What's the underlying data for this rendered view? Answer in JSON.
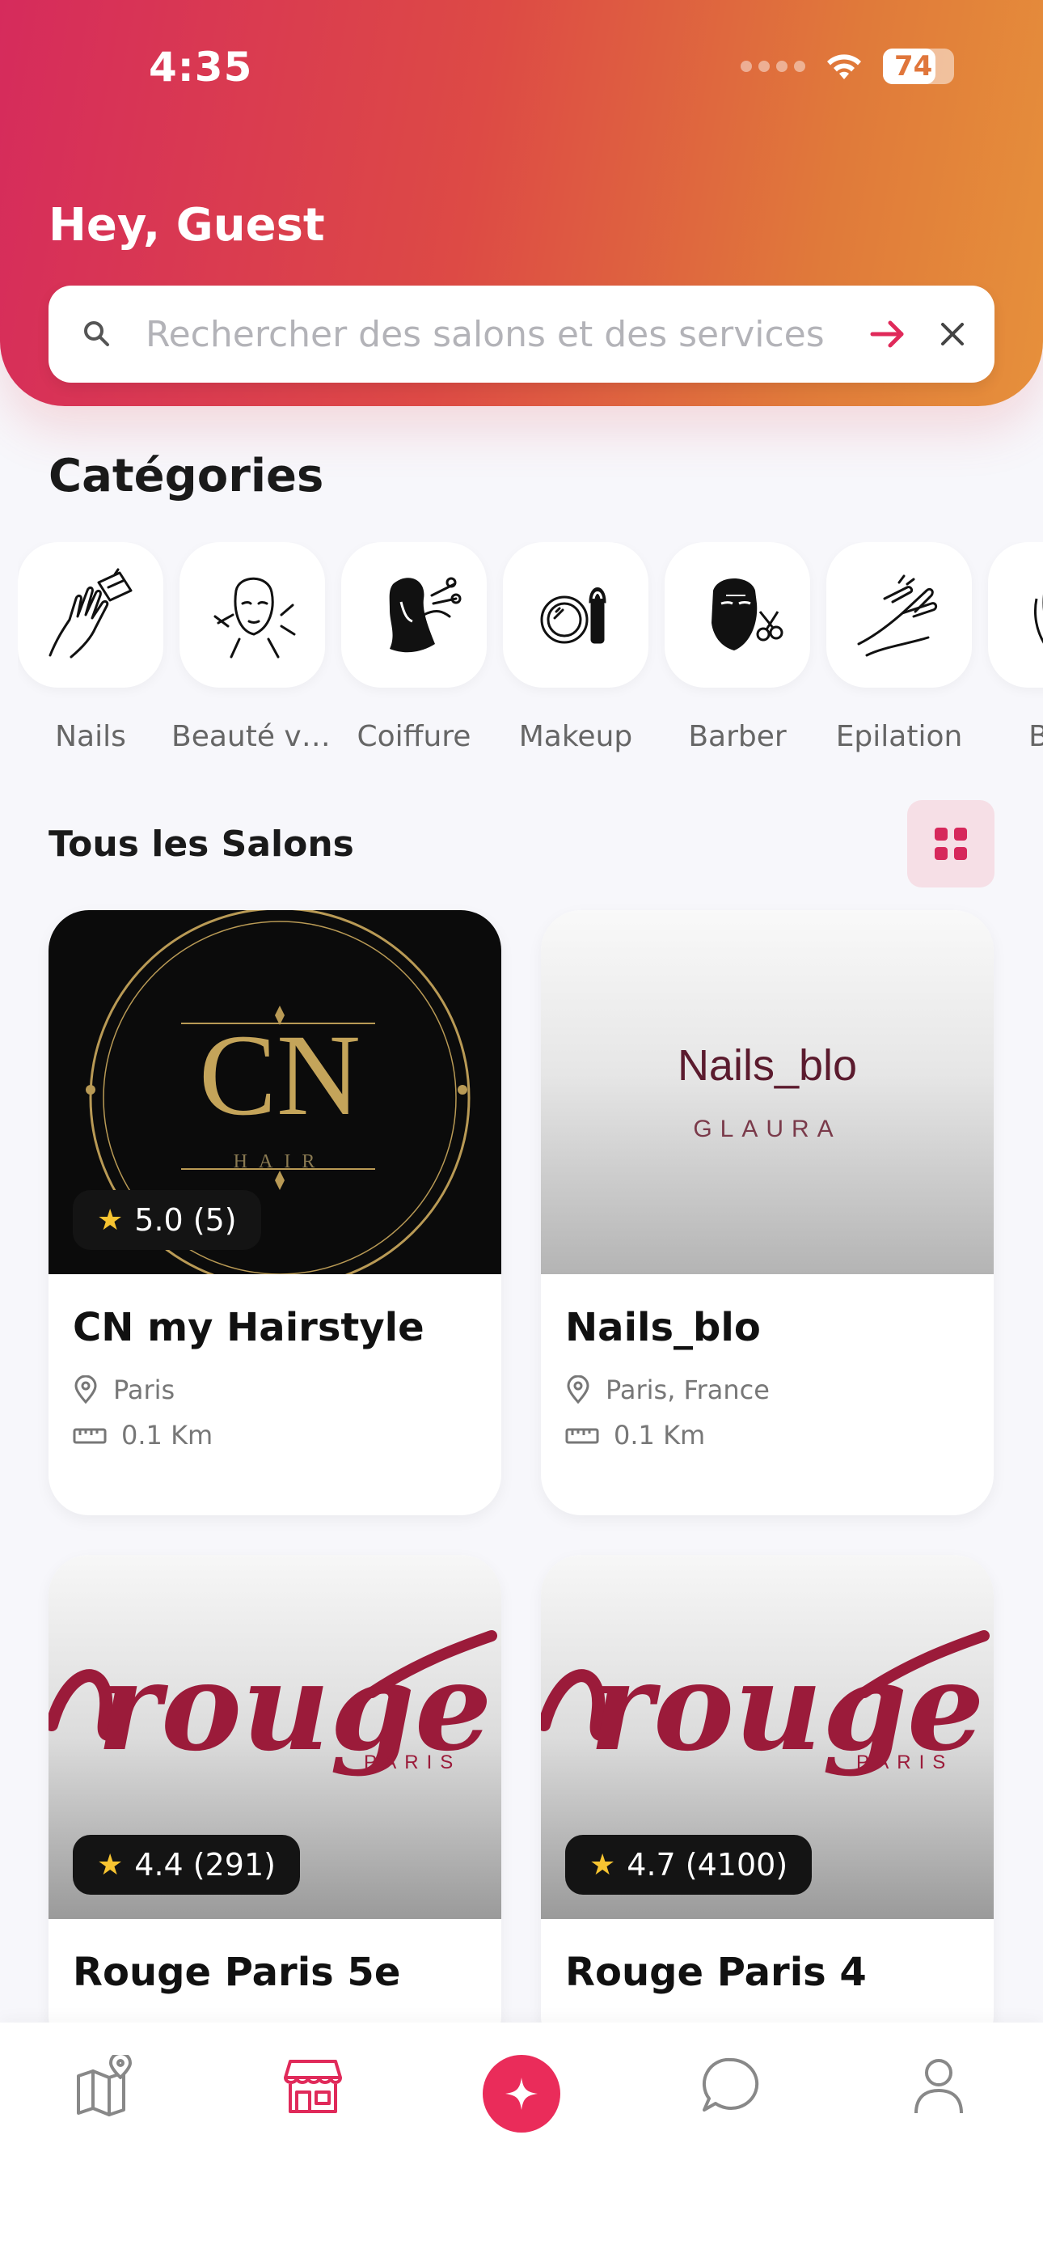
{
  "status": {
    "time": "4:35",
    "battery": "74",
    "battery_level": 0.74
  },
  "header": {
    "greeting": "Hey, Guest"
  },
  "search": {
    "placeholder": "Rechercher des salons et des services",
    "value": ""
  },
  "categories": {
    "title": "Catégories",
    "items": [
      {
        "label": "Nails",
        "icon": "nails-icon"
      },
      {
        "label": "Beauté vi…",
        "icon": "face-beauty-icon"
      },
      {
        "label": "Coiffure",
        "icon": "hair-icon"
      },
      {
        "label": "Makeup",
        "icon": "makeup-icon"
      },
      {
        "label": "Barber",
        "icon": "barber-icon"
      },
      {
        "label": "Epilation",
        "icon": "epilation-icon"
      },
      {
        "label": "Bien",
        "icon": "wellness-icon"
      }
    ]
  },
  "salons": {
    "title": "Tous les Salons",
    "cards": [
      {
        "name": "CN my Hairstyle",
        "location": "Paris",
        "distance": "0.1 Km",
        "rating": "5.0 (5)",
        "logo_main": "CN",
        "logo_sub": "HAIR"
      },
      {
        "name": "Nails_blo",
        "location": "Paris, France",
        "distance": "0.1 Km",
        "rating": "",
        "logo_main": "Nails_blo",
        "logo_sub": "GLAURA"
      },
      {
        "name": "Rouge Paris 5e",
        "location": "",
        "distance": "",
        "rating": "4.4 (291)",
        "logo_main": "rouge",
        "logo_sub": "PARIS"
      },
      {
        "name": "Rouge Paris 4",
        "location": "",
        "distance": "",
        "rating": "4.7 (4100)",
        "logo_main": "rouge",
        "logo_sub": "PARIS"
      }
    ]
  },
  "colors": {
    "accent": "#ea2c5a",
    "gradient_start": "#d62b5c",
    "gradient_end": "#e6903b",
    "rouge": "#9b1b3a"
  },
  "nav": {
    "items": [
      {
        "name": "map",
        "icon": "map-pin-icon"
      },
      {
        "name": "salons",
        "icon": "store-icon"
      },
      {
        "name": "center",
        "icon": "sparkle-icon"
      },
      {
        "name": "chat",
        "icon": "chat-bubble-icon"
      },
      {
        "name": "profile",
        "icon": "user-icon"
      }
    ]
  }
}
